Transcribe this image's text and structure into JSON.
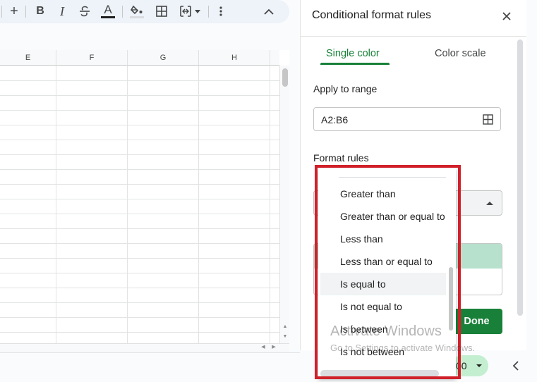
{
  "toolbar": {
    "items": [
      "add-icon",
      "bold-icon",
      "italic-icon",
      "strikethrough-icon",
      "text-color-icon",
      "fill-color-icon",
      "borders-icon",
      "merge-cells-icon",
      "more-vert-icon",
      "collapse-icon"
    ],
    "bold_label": "B",
    "italic_label": "I",
    "text_color_label": "A"
  },
  "grid": {
    "columns": [
      "E",
      "F",
      "G",
      "H"
    ]
  },
  "panel": {
    "title": "Conditional format rules",
    "tabs": [
      {
        "label": "Single color",
        "active": true
      },
      {
        "label": "Color scale",
        "active": false
      }
    ],
    "apply_to_range_label": "Apply to range",
    "range_value": "A2:B6",
    "format_rules_label": "Format rules",
    "done_label": "Done",
    "preview_fill_color": "#b7e1cd",
    "accent_color": "#188038"
  },
  "condition_dropdown": {
    "options": [
      "Greater than",
      "Greater than or equal to",
      "Less than",
      "Less than or equal to",
      "Is equal to",
      "Is not equal to",
      "Is between",
      "Is not between"
    ],
    "highlighted": "Is equal to",
    "annotation_color": "#d0202a"
  },
  "zoom": {
    "value": "00"
  },
  "watermark": {
    "title": "Activate Windows",
    "subtitle": "Go to Settings to activate Windows."
  }
}
